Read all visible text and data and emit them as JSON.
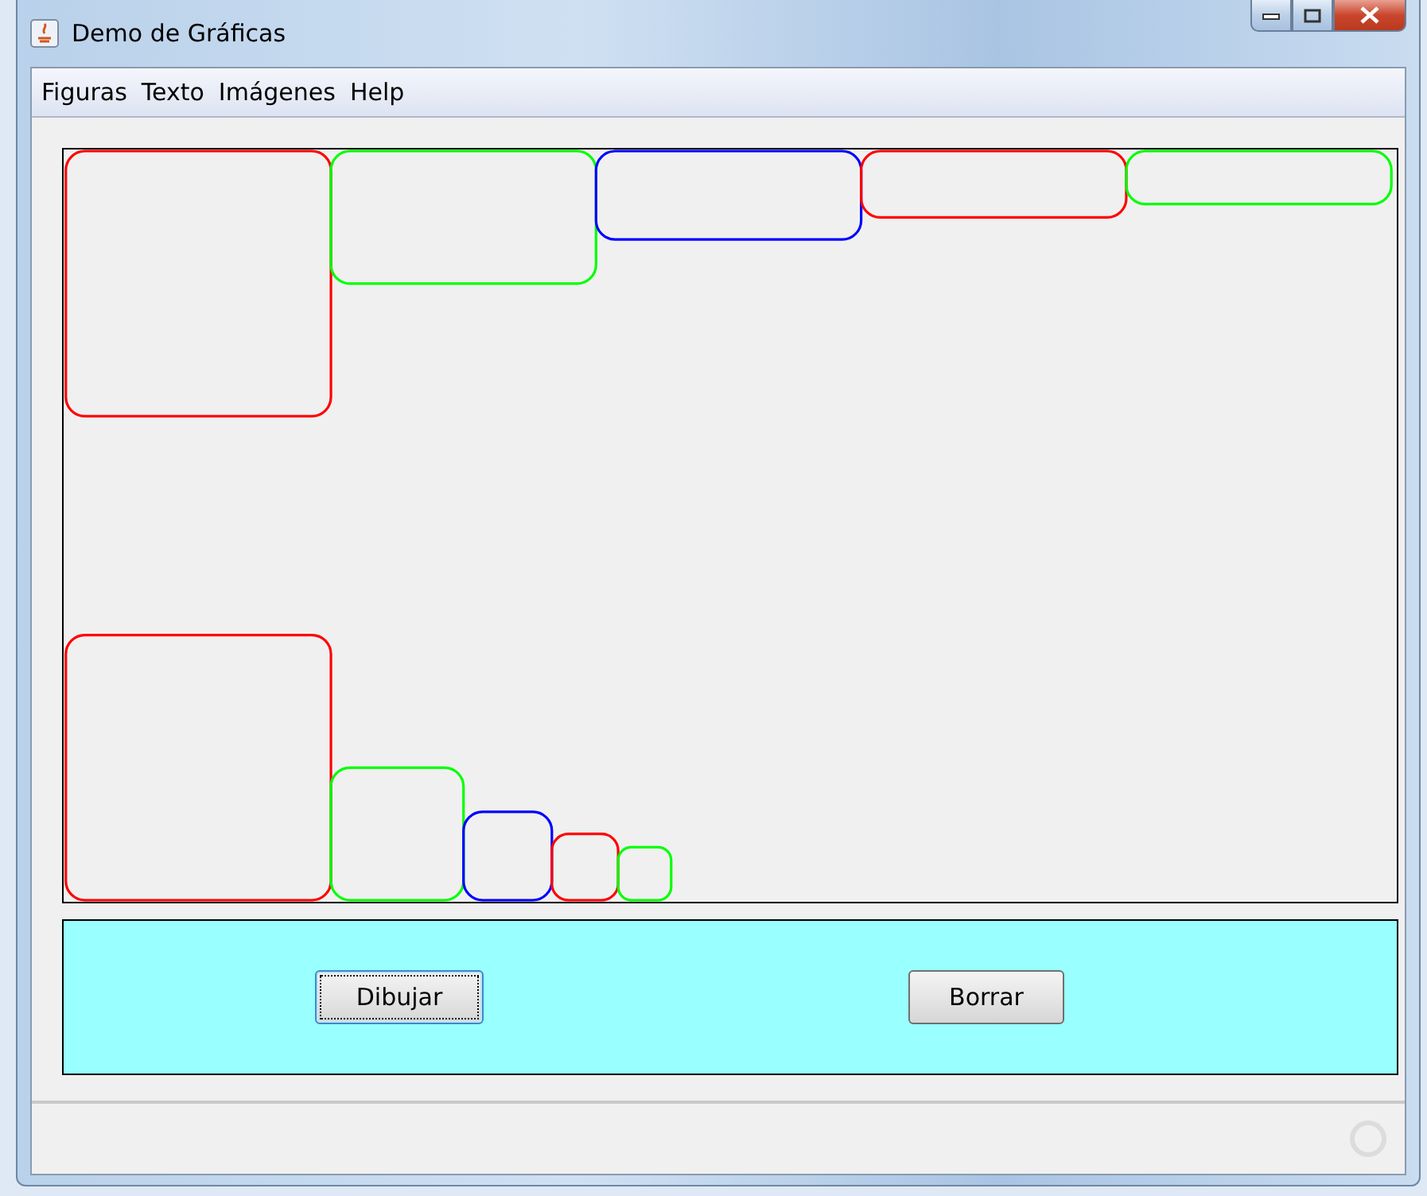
{
  "window": {
    "title": "Demo de Gráficas"
  },
  "menu": [
    "Figuras",
    "Texto",
    "Imágenes",
    "Help"
  ],
  "figures": {
    "top_row": [
      {
        "color": "#ff0000"
      },
      {
        "color": "#00ff00"
      },
      {
        "color": "#0000ff"
      },
      {
        "color": "#ff0000"
      },
      {
        "color": "#00ff00"
      }
    ],
    "bottom_row": [
      {
        "color": "#ff0000"
      },
      {
        "color": "#00ff00"
      },
      {
        "color": "#0000ff"
      },
      {
        "color": "#ff0000"
      },
      {
        "color": "#00ff00"
      }
    ]
  },
  "buttons": [
    {
      "label": "Dibujar",
      "focused": true
    },
    {
      "label": "Borrar",
      "focused": false
    }
  ]
}
